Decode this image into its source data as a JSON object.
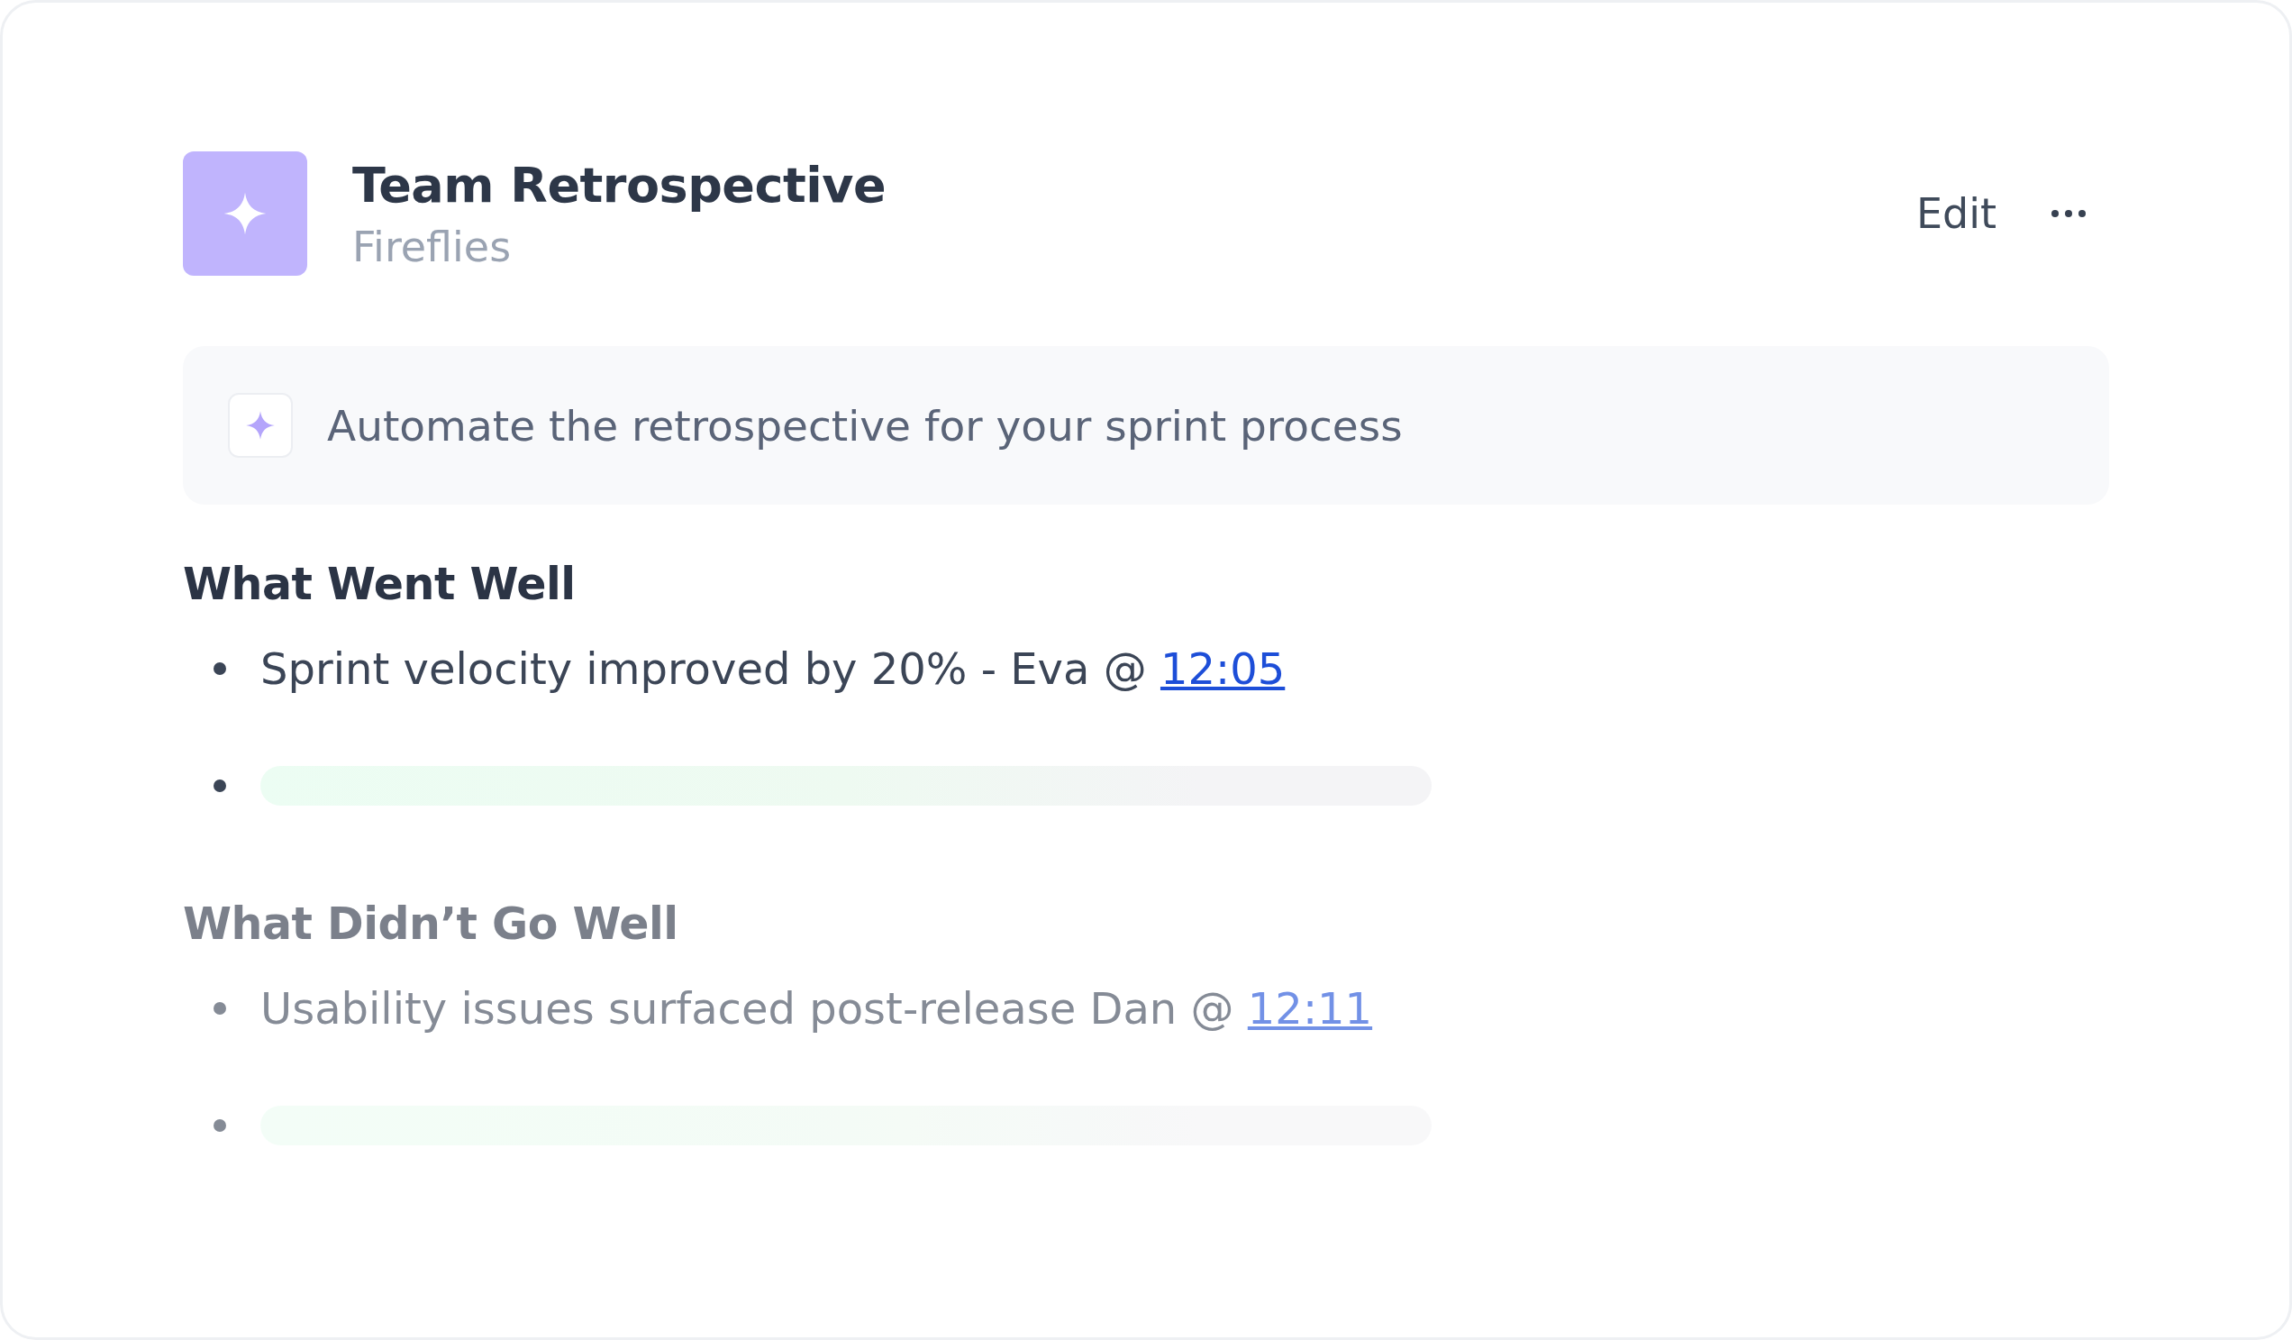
{
  "header": {
    "title": "Team Retrospective",
    "subtitle": "Fireflies",
    "actions": {
      "edit": "Edit"
    }
  },
  "prompt": {
    "text": "Automate the retrospective for your sprint process"
  },
  "sections": [
    {
      "heading": "What Went Well",
      "faded": false,
      "items": [
        {
          "kind": "text",
          "text": "Sprint velocity improved by 20% - Eva @ ",
          "link": "12:05"
        },
        {
          "kind": "skeleton"
        }
      ]
    },
    {
      "heading": "What Didn’t Go Well",
      "faded": true,
      "items": [
        {
          "kind": "text",
          "text": "Usability issues surfaced post-release Dan @ ",
          "link": "12:11"
        },
        {
          "kind": "skeleton"
        }
      ]
    }
  ]
}
